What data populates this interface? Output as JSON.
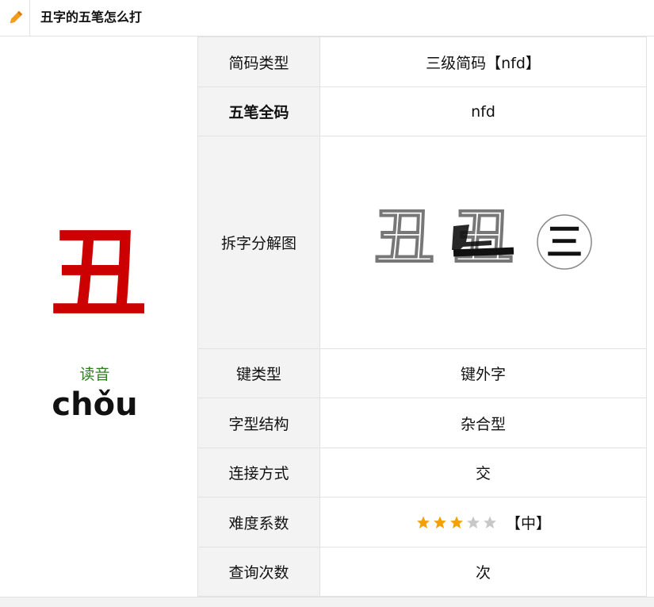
{
  "header": {
    "title": "丑字的五笔怎么打",
    "icon": "pencil-icon",
    "icon_color": "#f29b1d"
  },
  "character": {
    "glyph": "丑",
    "color": "#cc0000",
    "reading_label": "读音",
    "reading_label_color": "#2f7d1f",
    "pinyin": "chǒu"
  },
  "rows": [
    {
      "label": "简码类型",
      "value": "三级简码【nfd】"
    },
    {
      "label": "五笔全码",
      "value": "nfd"
    },
    {
      "label": "拆字分解图",
      "value": ""
    },
    {
      "label": "键类型",
      "value": "键外字"
    },
    {
      "label": "字型结构",
      "value": "杂合型"
    },
    {
      "label": "连接方式",
      "value": "交"
    },
    {
      "label": "难度系数",
      "value": "【中】",
      "stars": 3,
      "stars_max": 5
    },
    {
      "label": "查询次数",
      "value": "次"
    }
  ],
  "decomposition": {
    "components": [
      "丑",
      "丑",
      "三"
    ]
  },
  "colors": {
    "star_filled": "#f5a000",
    "star_empty": "#c8c8c8"
  }
}
